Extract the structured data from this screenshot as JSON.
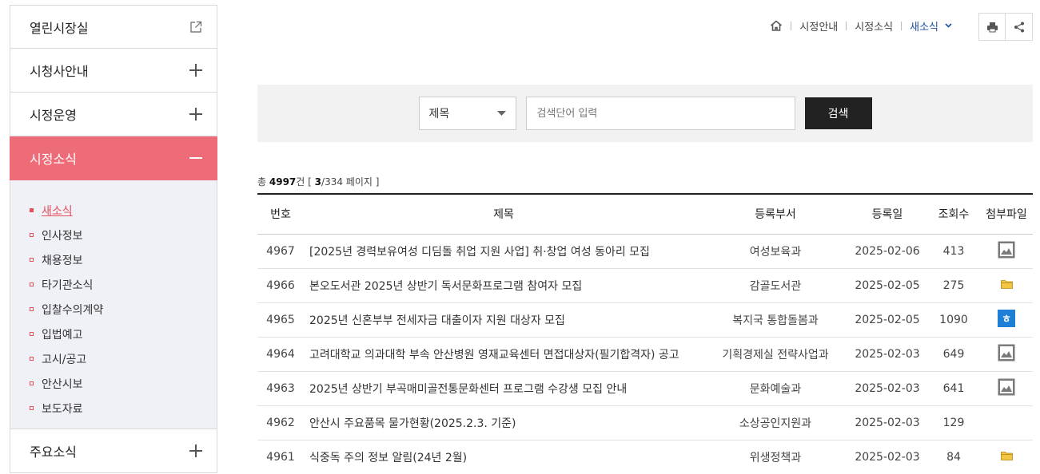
{
  "sidebar": {
    "items": [
      {
        "label": "열린시장실",
        "icon": "external-link-icon"
      },
      {
        "label": "시청사안내",
        "icon": "plus-icon"
      },
      {
        "label": "시정운영",
        "icon": "plus-icon"
      },
      {
        "label": "시정소식",
        "icon": "minus-icon",
        "active": true
      }
    ],
    "submenu": [
      "새소식",
      "인사정보",
      "채용정보",
      "타기관소식",
      "입찰수의계약",
      "입법예고",
      "고시/공고",
      "안산시보",
      "보도자료"
    ],
    "submenu_current": "새소식",
    "last_item": {
      "label": "주요소식",
      "icon": "plus-icon"
    }
  },
  "breadcrumb": {
    "home_icon": "home-icon",
    "items": [
      "시정안내",
      "시정소식"
    ],
    "current": "새소식"
  },
  "tools": {
    "print_icon": "print-icon",
    "share_icon": "share-icon"
  },
  "search": {
    "select_value": "제목",
    "placeholder": "검색단어 입력",
    "button_label": "검색"
  },
  "count": {
    "prefix": "총",
    "total": "4997",
    "unit": "건",
    "open": "[",
    "page": "3",
    "pages": "/334 페이지",
    "close": "]"
  },
  "table": {
    "headers": [
      "번호",
      "제목",
      "등록부서",
      "등록일",
      "조회수",
      "첨부파일"
    ],
    "rows": [
      {
        "no": "4967",
        "title": "[2025년 경력보유여성 디딤돌 취업 지원 사업] 취·창업 여성 동아리 모집",
        "dept": "여성보육과",
        "date": "2025-02-06",
        "views": "413",
        "file": "image-file-icon"
      },
      {
        "no": "4966",
        "title": "본오도서관 2025년 상반기 독서문화프로그램 참여자 모집",
        "dept": "감골도서관",
        "date": "2025-02-05",
        "views": "275",
        "file": "folder-file-icon"
      },
      {
        "no": "4965",
        "title": "2025년 신혼부부 전세자금 대출이자 지원 대상자 모집",
        "dept": "복지국 통합돌봄과",
        "date": "2025-02-05",
        "views": "1090",
        "file": "hwp-file-icon"
      },
      {
        "no": "4964",
        "title": "고려대학교 의과대학 부속 안산병원 영재교육센터 면접대상자(필기합격자) 공고",
        "dept": "기획경제실 전략사업과",
        "date": "2025-02-03",
        "views": "649",
        "file": "image-file-icon"
      },
      {
        "no": "4963",
        "title": "2025년 상반기 부곡매미골전통문화센터 프로그램 수강생 모집 안내",
        "dept": "문화예술과",
        "date": "2025-02-03",
        "views": "641",
        "file": "image-file-icon"
      },
      {
        "no": "4962",
        "title": "안산시 주요품목 물가현황(2025.2.3. 기준)",
        "dept": "소상공인지원과",
        "date": "2025-02-03",
        "views": "129",
        "file": ""
      },
      {
        "no": "4961",
        "title": "식중독 주의 정보 알림(24년 2월)",
        "dept": "위생정책과",
        "date": "2025-02-03",
        "views": "84",
        "file": "folder-file-icon"
      }
    ]
  },
  "colors": {
    "accent": "#ee6b78",
    "active_link": "#e6505e",
    "breadcrumb_current": "#1f4fa0",
    "hwp_icon": "#1f7ed6"
  }
}
